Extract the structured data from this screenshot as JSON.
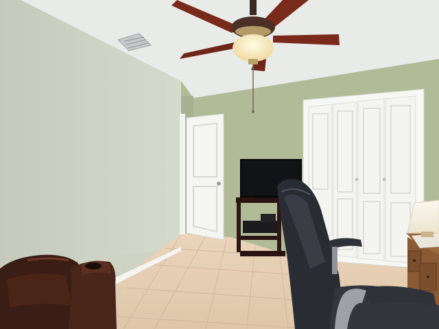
{
  "scene": {
    "kind": "interior-photo",
    "room": "bedroom-office",
    "objects": [
      "ceiling-fan",
      "ceiling-light",
      "air-vent",
      "interior-door",
      "bifold-closet-doors",
      "flat-screen-tv",
      "tv-stand",
      "office-chair",
      "leather-recliner",
      "table-lamp",
      "wooden-desk",
      "tile-floor"
    ]
  },
  "colors": {
    "wall_left": "#c9cfc0",
    "wall_back": "#b2bb98",
    "ceiling": "#eceeed",
    "floor": "#e6cfb4",
    "door": "#f5f5f2",
    "fan_blade": "#7a2a1a",
    "leather": "#3a1d15",
    "desk_wood": "#8a5a34",
    "chair": "#2a2c33"
  }
}
